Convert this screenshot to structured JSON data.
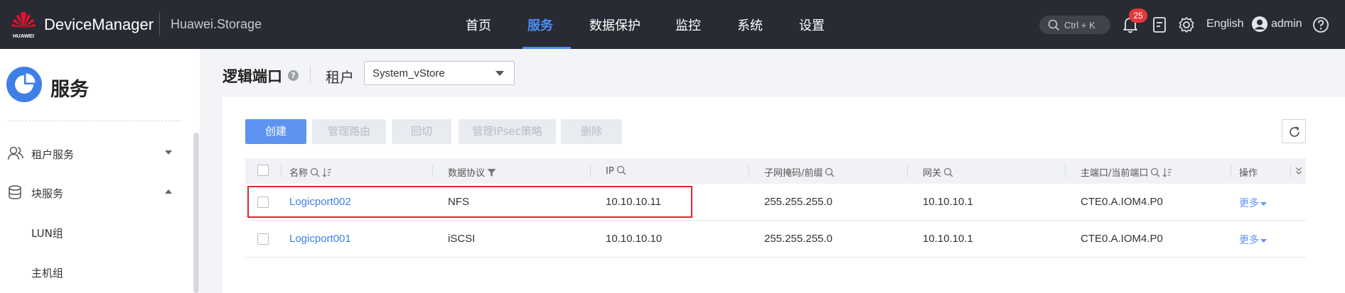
{
  "header": {
    "logo_text": "HUAWEI",
    "brand": "DeviceManager",
    "system_name": "Huawei.Storage",
    "nav": [
      {
        "label": "首页",
        "active": false
      },
      {
        "label": "服务",
        "active": true
      },
      {
        "label": "数据保护",
        "active": false
      },
      {
        "label": "监控",
        "active": false
      },
      {
        "label": "系统",
        "active": false
      },
      {
        "label": "设置",
        "active": false
      }
    ],
    "search_shortcut": "Ctrl + K",
    "notification_count": "25",
    "language": "English",
    "user": "admin",
    "accent_color": "#4e8ff7"
  },
  "sidebar": {
    "title": "服务",
    "items": [
      {
        "label": "租户服务",
        "icon": "users-icon",
        "expanded": false
      },
      {
        "label": "块服务",
        "icon": "database-icon",
        "expanded": true
      }
    ],
    "sub_items": [
      "LUN组",
      "主机组"
    ]
  },
  "main": {
    "title": "逻辑端口",
    "help": "?",
    "tenant_label": "租户",
    "tenant_value": "System_vStore"
  },
  "toolbar": {
    "create": "创建",
    "manage_route": "管理路由",
    "failback": "回切",
    "manage_ipsec": "管理IPsec策略",
    "delete": "删除"
  },
  "table": {
    "columns": [
      "名称",
      "数据协议",
      "IP",
      "子网掩码/前缀",
      "网关",
      "主端口/当前端口",
      "操作"
    ],
    "rows": [
      {
        "name": "Logicport002",
        "protocol": "NFS",
        "ip": "10.10.10.11",
        "mask": "255.255.255.0",
        "gateway": "10.10.10.1",
        "port": "CTE0.A.IOM4.P0",
        "action": "更多",
        "highlighted": true
      },
      {
        "name": "Logicport001",
        "protocol": "iSCSI",
        "ip": "10.10.10.10",
        "mask": "255.255.255.0",
        "gateway": "10.10.10.1",
        "port": "CTE0.A.IOM4.P0",
        "action": "更多",
        "highlighted": false
      }
    ]
  }
}
